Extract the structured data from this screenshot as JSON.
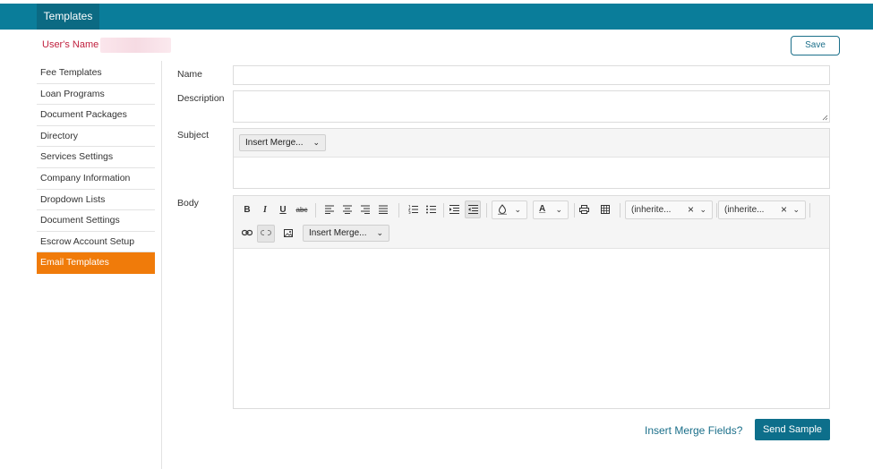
{
  "header": {
    "tab_label": "Templates"
  },
  "user": {
    "label": "User's Name :"
  },
  "actions": {
    "save_label": "Save",
    "merge_fields_link": "Insert Merge Fields?",
    "send_sample_label": "Send Sample"
  },
  "sidebar": {
    "items": [
      {
        "label": "Fee Templates",
        "active": false
      },
      {
        "label": "Loan Programs",
        "active": false
      },
      {
        "label": "Document Packages",
        "active": false
      },
      {
        "label": "Directory",
        "active": false
      },
      {
        "label": "Services Settings",
        "active": false
      },
      {
        "label": "Company Information",
        "active": false
      },
      {
        "label": "Dropdown Lists",
        "active": false
      },
      {
        "label": "Document Settings",
        "active": false
      },
      {
        "label": "Escrow Account Setup",
        "active": false
      },
      {
        "label": "Email Templates",
        "active": true
      }
    ]
  },
  "form": {
    "name_label": "Name",
    "description_label": "Description",
    "subject_label": "Subject",
    "body_label": "Body",
    "subject_merge_label": "Insert Merge...",
    "body_merge_label": "Insert Merge...",
    "font_family_value": "(inherite...",
    "font_size_value": "(inherite..."
  },
  "toolbar": {
    "bold": "B",
    "italic": "I",
    "underline": "U",
    "strike": "abc",
    "font_color_glyph": "A"
  },
  "colors": {
    "brand": "#0a7d9a",
    "active_nav": "#f07b0a",
    "username_label": "#c0213f"
  }
}
